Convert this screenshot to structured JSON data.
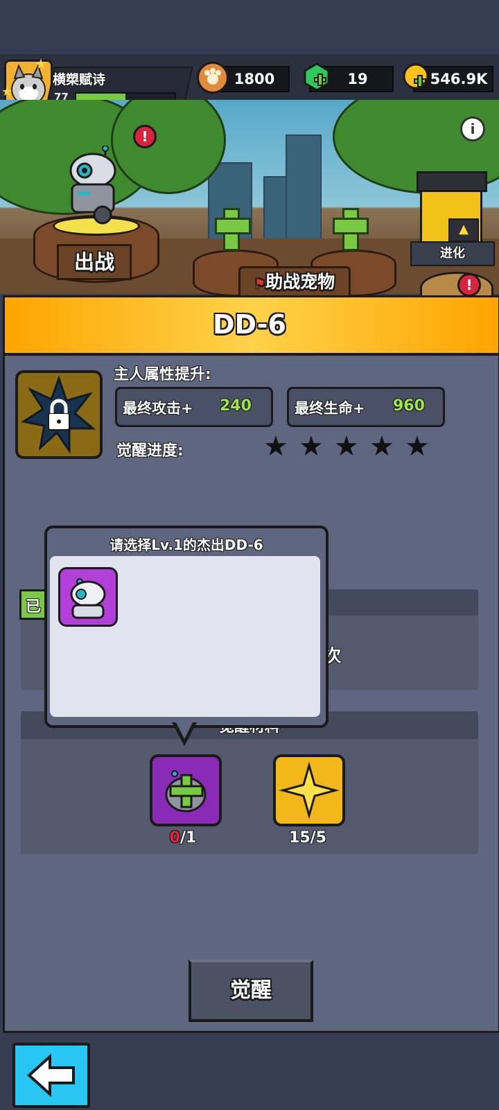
{
  "player": {
    "name": "横槊赋诗",
    "level": "77",
    "xp_fraction": 0.5
  },
  "resources": {
    "badge": "1800",
    "gems": "19",
    "gold": "546.9K"
  },
  "scene": {
    "deploy_label": "出战",
    "assist_label": "助战宠物",
    "evolve_label": "进化",
    "alert_glyph": "!",
    "info_glyph": "i"
  },
  "pet": {
    "name": "DD-6",
    "stat_heading": "主人属性提升:",
    "attack_label": "最终攻击+",
    "attack_value": "240",
    "hp_label": "最终生命+",
    "hp_value": "960",
    "awaken_progress_label": "觉醒进度:",
    "stars_total": 5,
    "star_glyph": "★"
  },
  "section1": {
    "tag_text": "已",
    "partial_text": "3次"
  },
  "materials": {
    "title": "觉醒材料",
    "items": [
      {
        "name": "pet-copy",
        "have": "0",
        "need": "/1"
      },
      {
        "name": "star-shard",
        "count": "15/5"
      }
    ]
  },
  "popup": {
    "title": "请选择Lv.1的杰出DD-6"
  },
  "buttons": {
    "awaken": "觉醒"
  },
  "colors": {
    "accent_green": "#7ac943",
    "banner_gold": "#ffb800",
    "back_button": "#28c6f2",
    "alert_red": "#d8243c"
  }
}
